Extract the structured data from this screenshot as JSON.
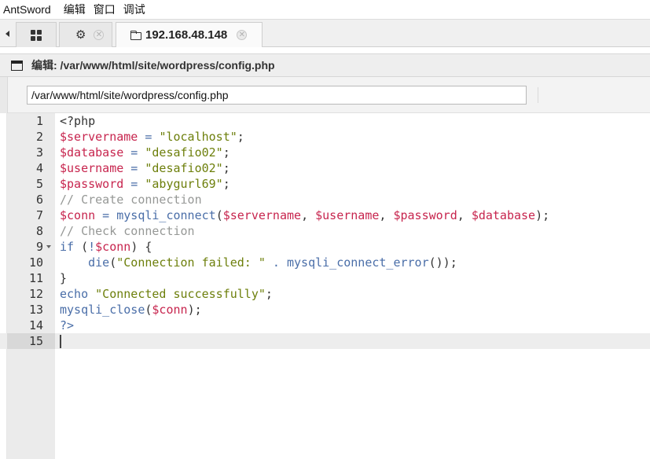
{
  "menubar": {
    "items": [
      "AntSword",
      "编辑",
      "窗口",
      "调试"
    ]
  },
  "tabs": {
    "host_label": "192.168.48.148"
  },
  "panel": {
    "title": "编辑: /var/www/html/site/wordpress/config.php"
  },
  "toolbar": {
    "path_value": "/var/www/html/site/wordpress/config.php"
  },
  "editor": {
    "active_line": 15,
    "lines": [
      {
        "n": "1",
        "tokens": [
          [
            "pl",
            "<?php"
          ]
        ]
      },
      {
        "n": "2",
        "tokens": [
          [
            "var",
            "$servername"
          ],
          [
            "op",
            " = "
          ],
          [
            "str",
            "\"localhost\""
          ],
          [
            "pl",
            ";"
          ]
        ]
      },
      {
        "n": "3",
        "tokens": [
          [
            "var",
            "$database"
          ],
          [
            "op",
            " = "
          ],
          [
            "str",
            "\"desafio02\""
          ],
          [
            "pl",
            ";"
          ]
        ]
      },
      {
        "n": "4",
        "tokens": [
          [
            "var",
            "$username"
          ],
          [
            "op",
            " = "
          ],
          [
            "str",
            "\"desafio02\""
          ],
          [
            "pl",
            ";"
          ]
        ]
      },
      {
        "n": "5",
        "tokens": [
          [
            "var",
            "$password"
          ],
          [
            "op",
            " = "
          ],
          [
            "str",
            "\"abygurl69\""
          ],
          [
            "pl",
            ";"
          ]
        ]
      },
      {
        "n": "6",
        "tokens": [
          [
            "cm",
            "// Create connection"
          ]
        ]
      },
      {
        "n": "7",
        "tokens": [
          [
            "var",
            "$conn"
          ],
          [
            "op",
            " = "
          ],
          [
            "fn",
            "mysqli_connect"
          ],
          [
            "pl",
            "("
          ],
          [
            "var",
            "$servername"
          ],
          [
            "pl",
            ", "
          ],
          [
            "var",
            "$username"
          ],
          [
            "pl",
            ", "
          ],
          [
            "var",
            "$password"
          ],
          [
            "pl",
            ", "
          ],
          [
            "var",
            "$database"
          ],
          [
            "pl",
            ");"
          ]
        ]
      },
      {
        "n": "8",
        "tokens": [
          [
            "cm",
            "// Check connection"
          ]
        ]
      },
      {
        "n": "9",
        "fold": true,
        "tokens": [
          [
            "kw",
            "if"
          ],
          [
            "pl",
            " ("
          ],
          [
            "op",
            "!"
          ],
          [
            "var",
            "$conn"
          ],
          [
            "pl",
            ") {"
          ]
        ]
      },
      {
        "n": "10",
        "tokens": [
          [
            "pl",
            "    "
          ],
          [
            "fn",
            "die"
          ],
          [
            "pl",
            "("
          ],
          [
            "str",
            "\"Connection failed: \""
          ],
          [
            "op",
            " . "
          ],
          [
            "fn",
            "mysqli_connect_error"
          ],
          [
            "pl",
            "());"
          ]
        ]
      },
      {
        "n": "11",
        "tokens": [
          [
            "pl",
            "}"
          ]
        ]
      },
      {
        "n": "12",
        "tokens": [
          [
            "kw",
            "echo"
          ],
          [
            "pl",
            " "
          ],
          [
            "str",
            "\"Connected successfully\""
          ],
          [
            "pl",
            ";"
          ]
        ]
      },
      {
        "n": "13",
        "tokens": [
          [
            "fn",
            "mysqli_close"
          ],
          [
            "pl",
            "("
          ],
          [
            "var",
            "$conn"
          ],
          [
            "pl",
            ");"
          ]
        ]
      },
      {
        "n": "14",
        "tokens": [
          [
            "tag",
            "?>"
          ]
        ]
      },
      {
        "n": "15",
        "tokens": []
      }
    ]
  }
}
